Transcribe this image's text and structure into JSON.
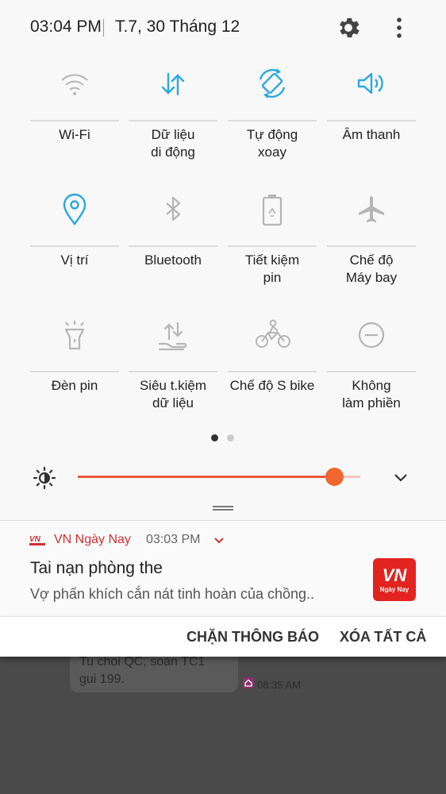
{
  "status": {
    "time": "03:04 PM",
    "date": "T.7, 30 Tháng 12"
  },
  "header": {
    "settings_icon": "gear-icon",
    "more_icon": "more-vert-icon"
  },
  "quick_settings": {
    "accent": "#29a8e0",
    "inactive": "#b5b5b5",
    "tiles": [
      {
        "label": "Wi-Fi",
        "icon": "wifi-icon",
        "active": false
      },
      {
        "label": "Dữ liệu\ndi động",
        "icon": "mobile-data-icon",
        "active": true
      },
      {
        "label": "Tự động\nxoay",
        "icon": "auto-rotate-icon",
        "active": true
      },
      {
        "label": "Âm thanh",
        "icon": "sound-icon",
        "active": true
      },
      {
        "label": "Vị trí",
        "icon": "location-icon",
        "active": true
      },
      {
        "label": "Bluetooth",
        "icon": "bluetooth-icon",
        "active": false
      },
      {
        "label": "Tiết kiệm\npin",
        "icon": "battery-saver-icon",
        "active": false
      },
      {
        "label": "Chế độ\nMáy bay",
        "icon": "airplane-icon",
        "active": false
      },
      {
        "label": "Đèn pin",
        "icon": "flashlight-icon",
        "active": false
      },
      {
        "label": "Siêu t.kiệm\ndữ liệu",
        "icon": "data-saver-icon",
        "active": false
      },
      {
        "label": "Chế độ S bike",
        "icon": "s-bike-icon",
        "active": false
      },
      {
        "label": "Không\nlàm phiền",
        "icon": "do-not-disturb-icon",
        "active": false
      }
    ],
    "page": 1,
    "pages": 2
  },
  "brightness": {
    "level": 0.91,
    "color": "#f06530",
    "icon": "brightness-icon",
    "expand_icon": "chevron-down-icon"
  },
  "notification": {
    "app": "VN Ngày Nay",
    "time": "03:03 PM",
    "title": "Tai nạn phòng the",
    "body": "Vợ phấn khích cắn nát tinh hoàn của chồng..",
    "logo_text": "VN",
    "logo_sub": "Ngày Nay",
    "accent": "#d32f2f"
  },
  "actions": {
    "block": "CHẶN THÔNG BÁO",
    "clear_all": "XÓA TẤT CẢ"
  },
  "background_message": {
    "text": "Tu choi QC, soan TC1\ngui 199.",
    "time": "08:35 AM"
  }
}
